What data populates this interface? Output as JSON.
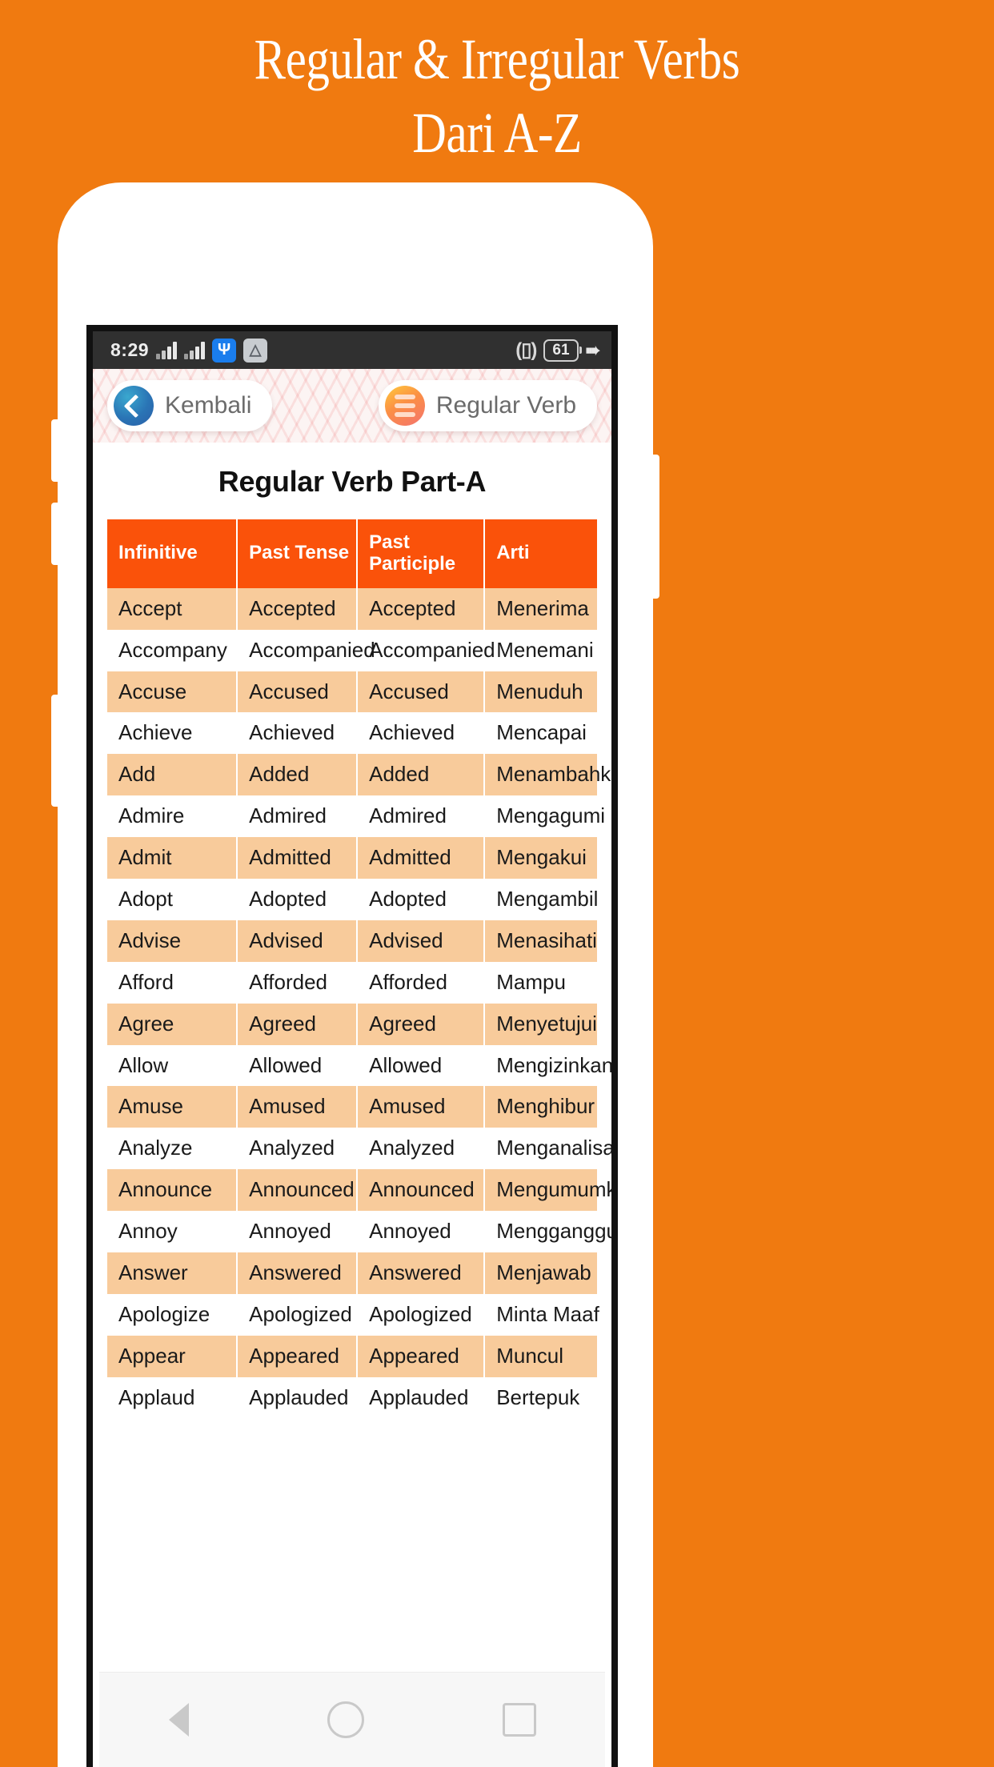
{
  "promo": {
    "line1": "Regular & Irregular Verbs",
    "line2": "Dari A-Z",
    "bg_color": "#F07A10"
  },
  "statusbar": {
    "time": "8:29",
    "usb_icon": "usb-icon",
    "app_icon": "app-store-icon",
    "signal_icon": "signal-bars-icon",
    "vibrate": "(▯)",
    "battery_level": "61",
    "charging": "⚡"
  },
  "header": {
    "back_button": "Kembali",
    "menu_button": "Regular Verb",
    "back_icon": "chevron-left-icon",
    "menu_icon": "hamburger-menu-icon"
  },
  "main": {
    "section_title": "Regular Verb Part-A",
    "columns": [
      "Infinitive",
      "Past Tense",
      "Past\nParticiple",
      "Arti"
    ],
    "col_infinitive": "Infinitive",
    "col_past_tense": "Past Tense",
    "col_past_participle_a": "Past",
    "col_past_participle_b": "Participle",
    "col_arti": "Arti",
    "rows": [
      [
        "Accept",
        "Accepted",
        "Accepted",
        "Menerima"
      ],
      [
        "Accompany",
        "Accompanied",
        "Accompanied",
        "Menemani"
      ],
      [
        "Accuse",
        "Accused",
        "Accused",
        "Menuduh"
      ],
      [
        "Achieve",
        "Achieved",
        "Achieved",
        "Mencapai"
      ],
      [
        "Add",
        "Added",
        "Added",
        "Menambahkan"
      ],
      [
        "Admire",
        "Admired",
        "Admired",
        "Mengagumi"
      ],
      [
        "Admit",
        "Admitted",
        "Admitted",
        "Mengakui"
      ],
      [
        "Adopt",
        "Adopted",
        "Adopted",
        "Mengambil"
      ],
      [
        "Advise",
        "Advised",
        "Advised",
        "Menasihati"
      ],
      [
        "Afford",
        "Afforded",
        "Afforded",
        "Mampu"
      ],
      [
        "Agree",
        "Agreed",
        "Agreed",
        "Menyetujui"
      ],
      [
        "Allow",
        "Allowed",
        "Allowed",
        "Mengizinkan"
      ],
      [
        "Amuse",
        "Amused",
        "Amused",
        "Menghibur"
      ],
      [
        "Analyze",
        "Analyzed",
        "Analyzed",
        "Menganalisa"
      ],
      [
        "Announce",
        "Announced",
        "Announced",
        "Mengumumkan"
      ],
      [
        "Annoy",
        "Annoyed",
        "Annoyed",
        "Mengganggu"
      ],
      [
        "Answer",
        "Answered",
        "Answered",
        "Menjawab"
      ],
      [
        "Apologize",
        "Apologized",
        "Apologized",
        "Minta Maaf"
      ],
      [
        "Appear",
        "Appeared",
        "Appeared",
        "Muncul"
      ],
      [
        "Applaud",
        "Applauded",
        "Applauded",
        "Bertepuk"
      ]
    ],
    "accent_header": "#FA520A",
    "row_alt": "#F8CB9B"
  },
  "navbar": {
    "back": "back-triangle",
    "home": "home-circle",
    "recent": "recent-square"
  }
}
